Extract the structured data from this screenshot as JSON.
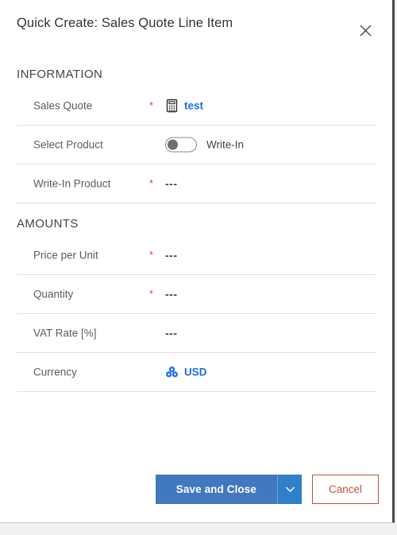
{
  "header": {
    "title": "Quick Create: Sales Quote Line Item",
    "close_icon": "close-icon"
  },
  "sections": [
    {
      "name": "information",
      "title": "INFORMATION",
      "fields": [
        {
          "label": "Sales Quote",
          "required": "*",
          "type": "lookup",
          "icon": "calculator-icon",
          "value": "test"
        },
        {
          "label": "Select Product",
          "required": "",
          "type": "toggle",
          "toggle_state": "off",
          "value": "Write-In"
        },
        {
          "label": "Write-In Product",
          "required": "*",
          "type": "text",
          "value": "---"
        }
      ]
    },
    {
      "name": "amounts",
      "title": "AMOUNTS",
      "fields": [
        {
          "label": "Price per Unit",
          "required": "*",
          "type": "text",
          "value": "---"
        },
        {
          "label": "Quantity",
          "required": "*",
          "type": "text",
          "value": "---"
        },
        {
          "label": "VAT Rate [%]",
          "required": "",
          "type": "text",
          "value": "---"
        },
        {
          "label": "Currency",
          "required": "",
          "type": "lookup",
          "icon": "currency-icon",
          "value": "USD"
        }
      ]
    }
  ],
  "footer": {
    "save_label": "Save and Close",
    "save_dropdown_icon": "chevron-down-icon",
    "cancel_label": "Cancel"
  },
  "colors": {
    "accent_blue": "#4178be",
    "dropdown_blue": "#2f7fc9",
    "link_blue": "#1a6eeb",
    "required_red": "#e8403a",
    "cancel_red": "#c0503c",
    "divider": "#e2e2e2"
  }
}
